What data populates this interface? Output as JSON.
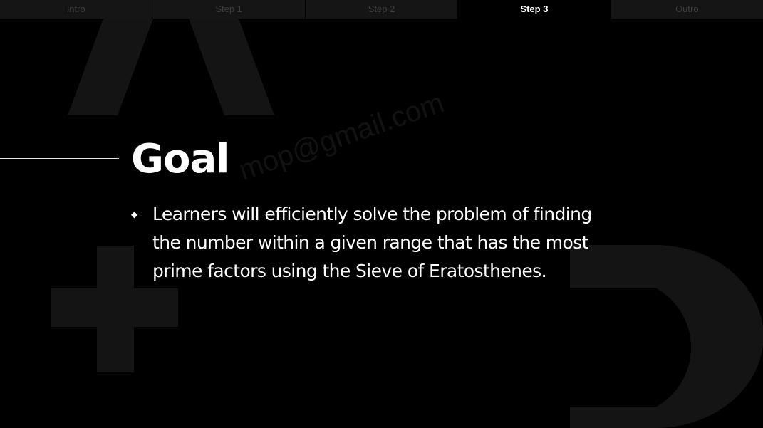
{
  "tabs": [
    {
      "label": "Intro",
      "active": false
    },
    {
      "label": "Step 1",
      "active": false
    },
    {
      "label": "Step 2",
      "active": false
    },
    {
      "label": "Step 3",
      "active": true
    },
    {
      "label": "Outro",
      "active": false
    }
  ],
  "slide": {
    "title": "Goal",
    "bullets": [
      {
        "marker": "◆",
        "text": "Learners will efficiently solve the problem of finding the number within a given range that has the most prime factors using the Sieve of Eratosthenes."
      }
    ]
  },
  "watermark": "mop@gmail.com",
  "colors": {
    "background": "#000000",
    "text": "#ffffff",
    "tab_inactive_bg": "#151515",
    "tab_inactive_text": "#3d3d3d",
    "decor_shape": "#141414"
  }
}
